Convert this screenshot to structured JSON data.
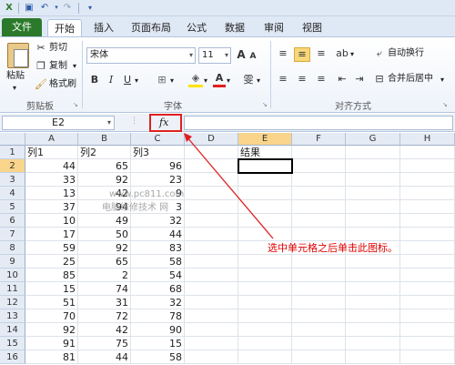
{
  "ribbon_tabs": [
    "文件",
    "开始",
    "插入",
    "页面布局",
    "公式",
    "数据",
    "审阅",
    "视图"
  ],
  "clipboard": {
    "paste": "粘贴",
    "cut": "剪切",
    "copy": "复制",
    "format_painter": "格式刷",
    "group_label": "剪贴板"
  },
  "font": {
    "name": "宋体",
    "size": "11",
    "grow": "A",
    "shrink": "A",
    "bold": "B",
    "italic": "I",
    "underline": "U",
    "font_color_glyph": "A",
    "phonetic": "雯",
    "group_label": "字体"
  },
  "alignment": {
    "wrap_text": "自动换行",
    "merge_center": "合并后居中",
    "group_label": "对齐方式"
  },
  "formula_bar": {
    "name_box": "E2",
    "fx_label": "fx",
    "value": ""
  },
  "columns": [
    "A",
    "B",
    "C",
    "D",
    "E",
    "F",
    "G",
    "H"
  ],
  "selected_column": "E",
  "rows": [
    {
      "n": "1",
      "a": "列1",
      "b": "列2",
      "c": "列3",
      "e": "结果"
    },
    {
      "n": "2",
      "a": "44",
      "b": "65",
      "c": "96",
      "e": ""
    },
    {
      "n": "3",
      "a": "33",
      "b": "92",
      "c": "23",
      "e": ""
    },
    {
      "n": "4",
      "a": "13",
      "b": "42",
      "c": "9",
      "e": ""
    },
    {
      "n": "5",
      "a": "37",
      "b": "94",
      "c": "3",
      "e": ""
    },
    {
      "n": "6",
      "a": "10",
      "b": "49",
      "c": "32",
      "e": ""
    },
    {
      "n": "7",
      "a": "17",
      "b": "50",
      "c": "44",
      "e": ""
    },
    {
      "n": "8",
      "a": "59",
      "b": "92",
      "c": "83",
      "e": ""
    },
    {
      "n": "9",
      "a": "25",
      "b": "65",
      "c": "58",
      "e": ""
    },
    {
      "n": "10",
      "a": "85",
      "b": "2",
      "c": "54",
      "e": ""
    },
    {
      "n": "11",
      "a": "15",
      "b": "74",
      "c": "68",
      "e": ""
    },
    {
      "n": "12",
      "a": "51",
      "b": "31",
      "c": "32",
      "e": ""
    },
    {
      "n": "13",
      "a": "70",
      "b": "72",
      "c": "78",
      "e": ""
    },
    {
      "n": "14",
      "a": "92",
      "b": "42",
      "c": "90",
      "e": ""
    },
    {
      "n": "15",
      "a": "91",
      "b": "75",
      "c": "15",
      "e": ""
    },
    {
      "n": "16",
      "a": "81",
      "b": "44",
      "c": "58",
      "e": ""
    }
  ],
  "selected_row": "2",
  "watermark": {
    "line1": "www.pc811.com",
    "line2": "电脑维修技术 网"
  },
  "annotation": "选中单元格之后单击此图标。",
  "colors": {
    "accent_red": "#e02020",
    "file_tab": "#2b7a2b",
    "selected_header": "#f9d58c"
  }
}
